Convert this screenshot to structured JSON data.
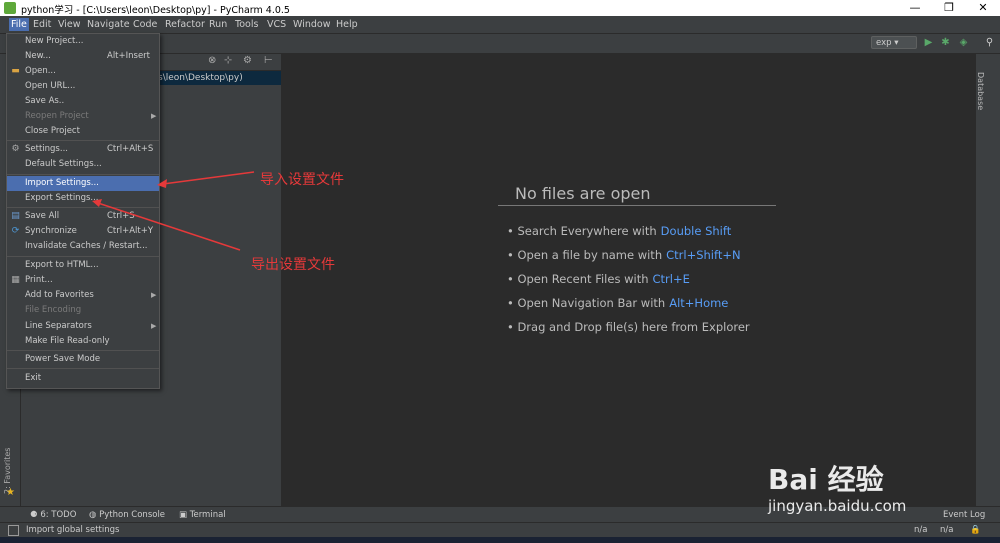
{
  "window": {
    "title": "python学习 - [C:\\Users\\leon\\Desktop\\py] - PyCharm 4.0.5",
    "controls": [
      "—",
      "❐",
      "✕"
    ]
  },
  "menubar": [
    "File",
    "Edit",
    "View",
    "Navigate",
    "Code",
    "Refactor",
    "Run",
    "Tools",
    "VCS",
    "Window",
    "Help"
  ],
  "toolbar": {
    "run_config": "exp ▾"
  },
  "project": {
    "path_fragment": "s\\leon\\Desktop\\py)"
  },
  "file_menu": [
    {
      "label": "New Project...",
      "shortcut": ""
    },
    {
      "label": "New...",
      "shortcut": "Alt+Insert"
    },
    {
      "label": "Open...",
      "shortcut": ""
    },
    {
      "label": "Open URL...",
      "shortcut": ""
    },
    {
      "label": "Save As..",
      "shortcut": ""
    },
    {
      "label": "Reopen Project",
      "shortcut": ""
    },
    {
      "label": "Close Project",
      "shortcut": ""
    },
    {
      "label": "Settings...",
      "shortcut": "Ctrl+Alt+S"
    },
    {
      "label": "Default Settings...",
      "shortcut": ""
    },
    {
      "label": "Import Settings...",
      "shortcut": ""
    },
    {
      "label": "Export Settings...",
      "shortcut": ""
    },
    {
      "label": "Save All",
      "shortcut": "Ctrl+S"
    },
    {
      "label": "Synchronize",
      "shortcut": "Ctrl+Alt+Y"
    },
    {
      "label": "Invalidate Caches / Restart...",
      "shortcut": ""
    },
    {
      "label": "Export to HTML...",
      "shortcut": ""
    },
    {
      "label": "Print...",
      "shortcut": ""
    },
    {
      "label": "Add to Favorites",
      "shortcut": ""
    },
    {
      "label": "File Encoding",
      "shortcut": ""
    },
    {
      "label": "Line Separators",
      "shortcut": ""
    },
    {
      "label": "Make File Read-only",
      "shortcut": ""
    },
    {
      "label": "Power Save Mode",
      "shortcut": ""
    },
    {
      "label": "Exit",
      "shortcut": ""
    }
  ],
  "editor": {
    "empty_title": "No files are open",
    "hints": [
      {
        "text": "• Search Everywhere with",
        "key": "Double Shift"
      },
      {
        "text": "• Open a file by name with",
        "key": "Ctrl+Shift+N"
      },
      {
        "text": "• Open Recent Files with",
        "key": "Ctrl+E"
      },
      {
        "text": "• Open Navigation Bar with",
        "key": "Alt+Home"
      },
      {
        "text": "• Drag and Drop file(s) here from Explorer",
        "key": ""
      }
    ]
  },
  "side": {
    "database": "Database",
    "favorites": "2: Favorites"
  },
  "bottom": {
    "todo": "6: TODO",
    "console": "Python Console",
    "terminal": "Terminal",
    "event_log": "Event Log"
  },
  "status": {
    "message": "Import global settings",
    "na1": "n/a",
    "na2": "n/a"
  },
  "annotations": {
    "import": "导入设置文件",
    "export": "导出设置文件"
  },
  "watermark": {
    "logo": "Bai  经验",
    "url": "jingyan.baidu.com"
  },
  "colors": {
    "accent": "#4b6eaf",
    "key": "#589df6",
    "annotation": "#e5393a"
  }
}
